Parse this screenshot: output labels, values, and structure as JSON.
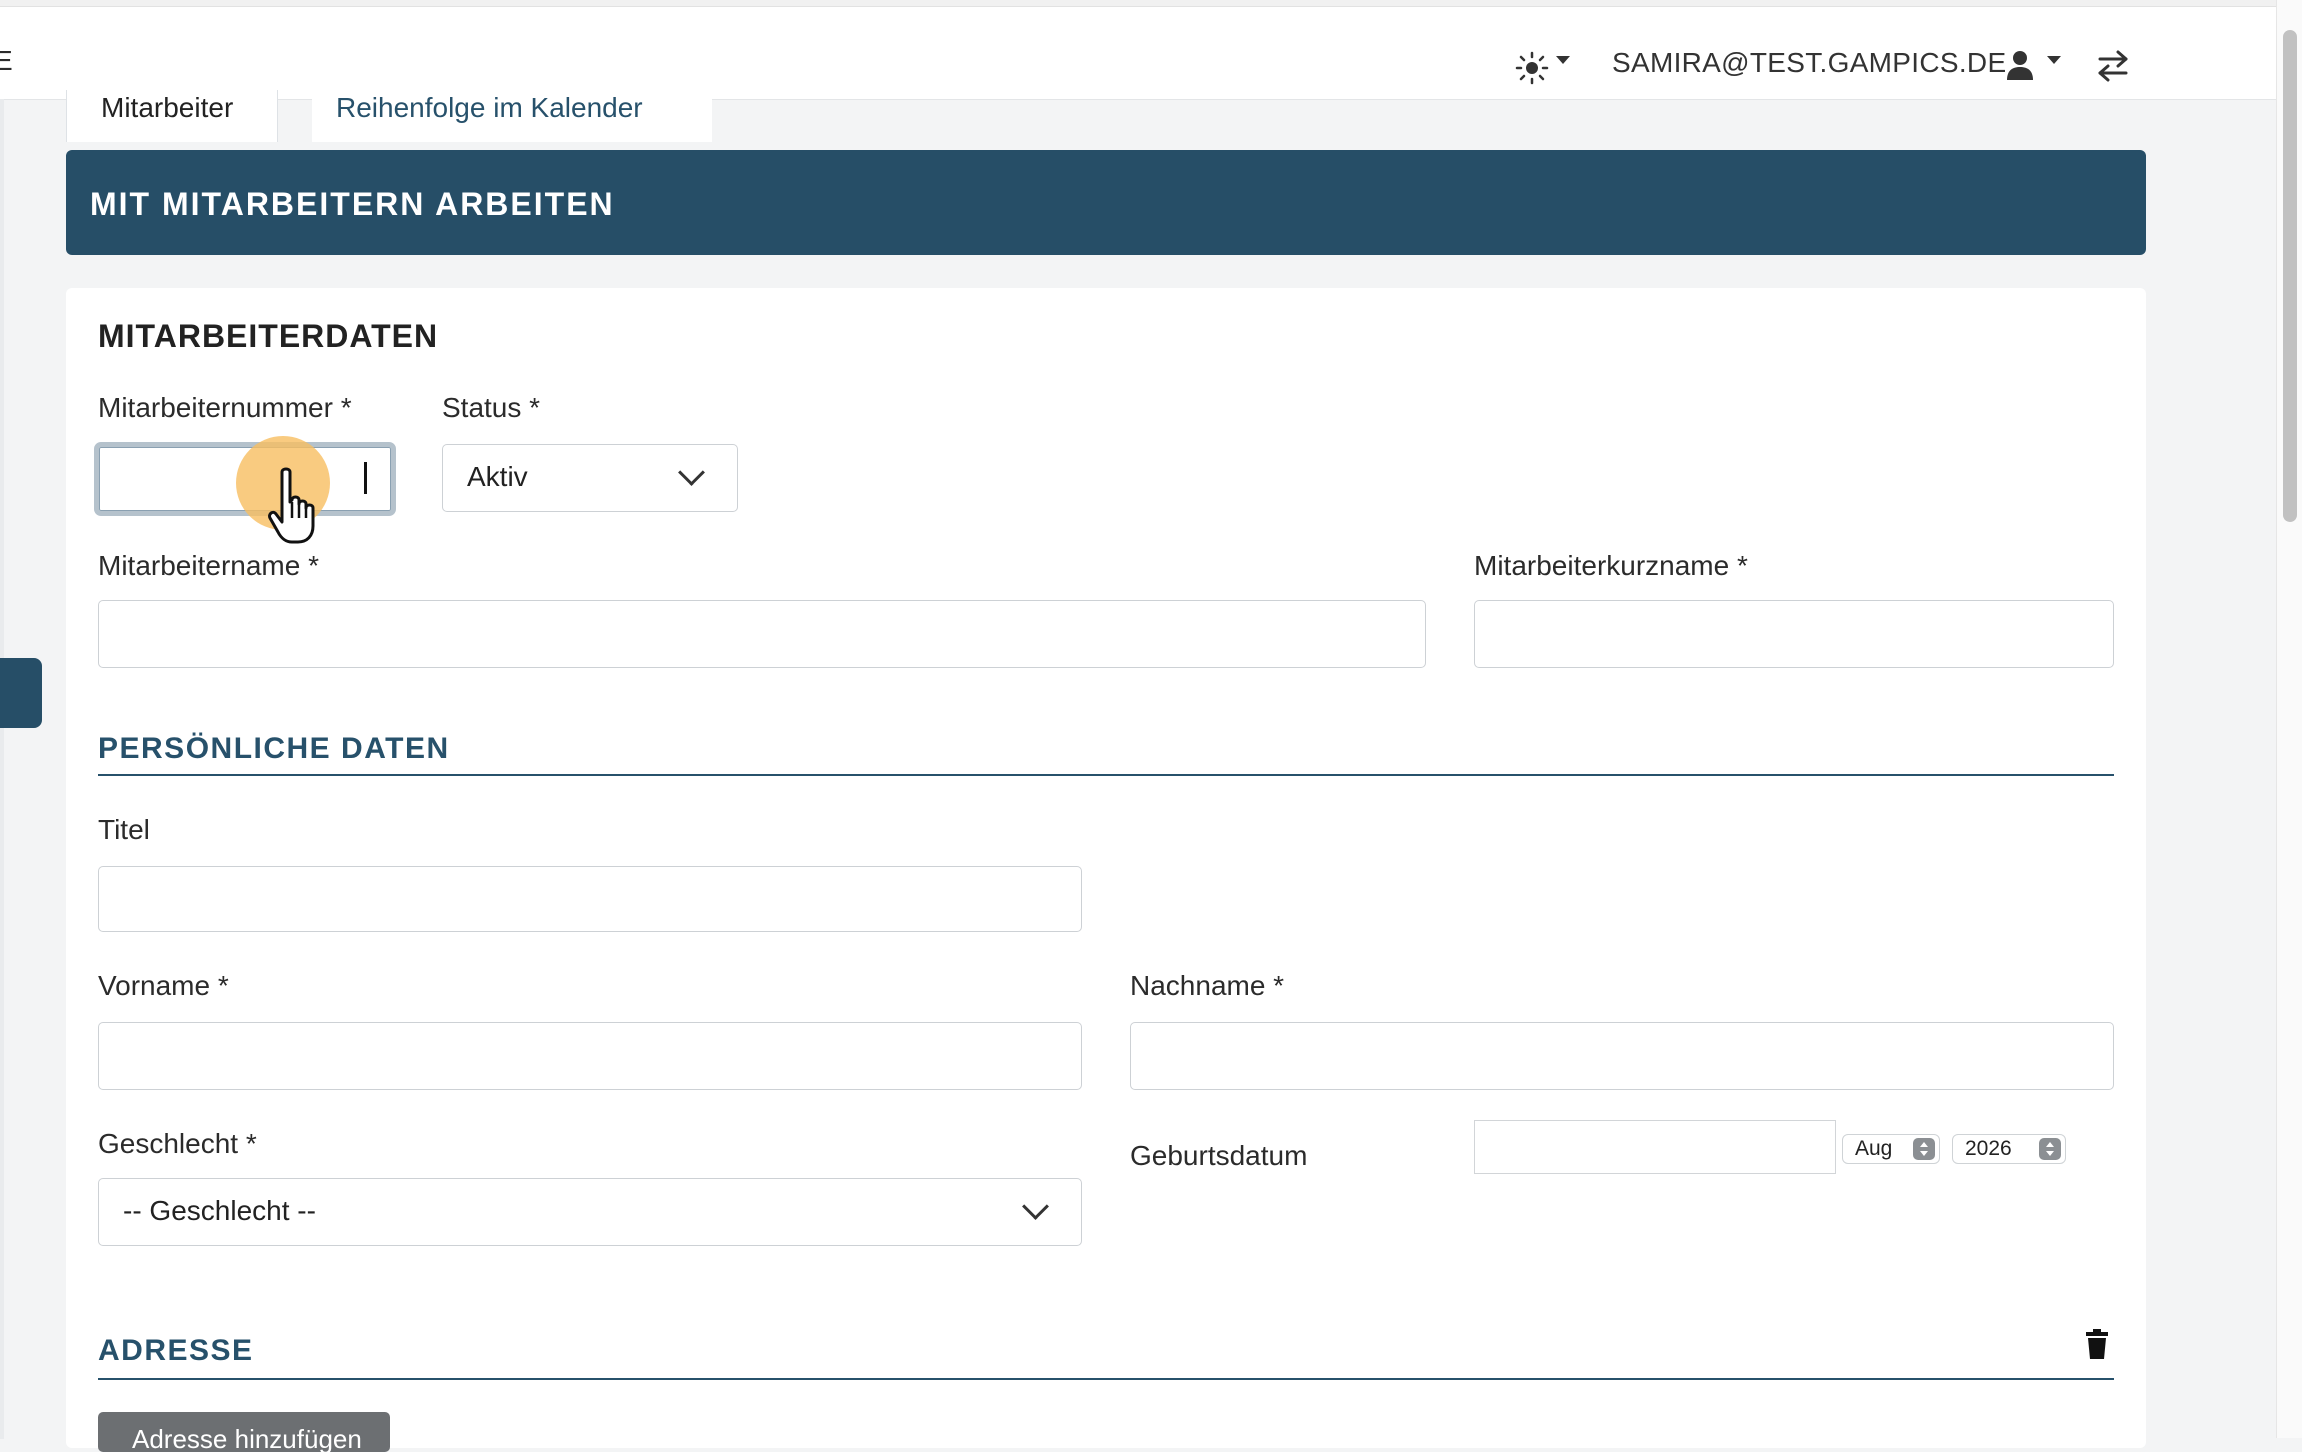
{
  "header": {
    "edge_letter": "E",
    "user_email": "SAMIRA@TEST.GAMPICS.DE"
  },
  "icons": {
    "theme": "sun-icon",
    "user": "user-icon",
    "switch": "arrows-swap-icon",
    "trash": "trash-icon",
    "cursor": "hand-pointer-icon"
  },
  "tabs": [
    {
      "label": "Mitarbeiter",
      "active": true
    },
    {
      "label": "Reihenfolge im Kalender",
      "active": false
    }
  ],
  "banner": {
    "title": "MIT MITARBEITERN ARBEITEN"
  },
  "form": {
    "section_title": "MITARBEITERDATEN",
    "employee_number": {
      "label": "Mitarbeiternummer *",
      "value": ""
    },
    "status": {
      "label": "Status *",
      "value": "Aktiv"
    },
    "employee_name": {
      "label": "Mitarbeitername *",
      "value": ""
    },
    "employee_shortname": {
      "label": "Mitarbeiterkurzname *",
      "value": ""
    },
    "personal": {
      "title": "PERSÖNLICHE DATEN",
      "titel": {
        "label": "Titel",
        "value": ""
      },
      "vorname": {
        "label": "Vorname *",
        "value": ""
      },
      "nachname": {
        "label": "Nachname *",
        "value": ""
      },
      "geschlecht": {
        "label": "Geschlecht *",
        "value": "-- Geschlecht --"
      },
      "geburtsdatum": {
        "label": "Geburtsdatum",
        "value": "",
        "month": "Aug",
        "year": "2026"
      }
    },
    "address": {
      "title": "ADRESSE",
      "add_button": "Adresse hinzufügen"
    }
  },
  "colors": {
    "primary": "#264e67",
    "accent_text": "#27516b",
    "button_gray": "#6c6f72",
    "cursor_halo": "#f7be60"
  }
}
